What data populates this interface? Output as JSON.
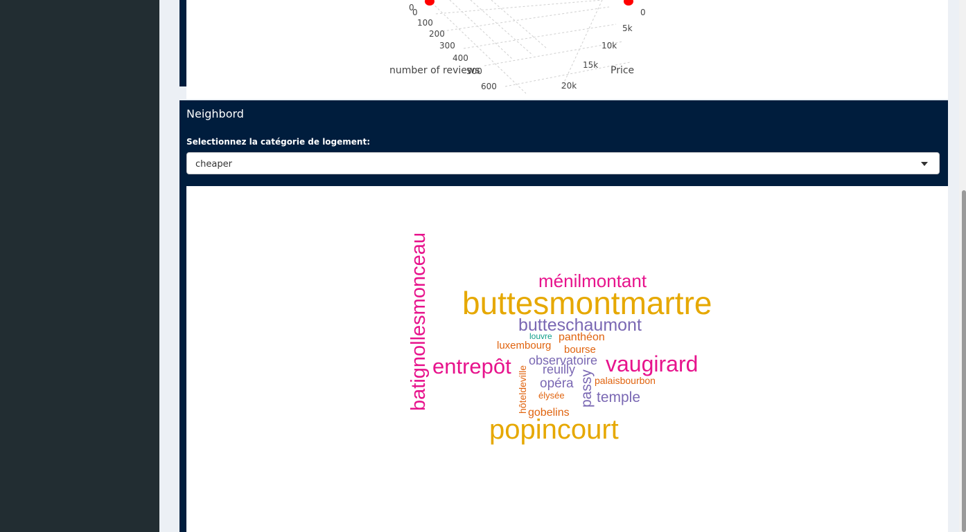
{
  "chart3d": {
    "x_axis_title": "number of reviews",
    "x_ticks": [
      "0",
      "100",
      "200",
      "300",
      "400",
      "500",
      "600"
    ],
    "y_axis_title": "Price",
    "y_ticks": [
      "0",
      "5k",
      "10k",
      "15k",
      "20k"
    ],
    "z_tick_visible": "0",
    "point_color": "#ff0000"
  },
  "neighbord": {
    "title": "Neighbord",
    "select_label": "Selectionnez la catégorie de logement:",
    "select_value": "cheaper"
  },
  "wordcloud": {
    "words": [
      {
        "text": "buttesmontmartre",
        "color": "#e6a800"
      },
      {
        "text": "popincourt",
        "color": "#e6a800"
      },
      {
        "text": "ménilmontant",
        "color": "#e7138c"
      },
      {
        "text": "vaugirard",
        "color": "#e7138c"
      },
      {
        "text": "entrepôt",
        "color": "#e7138c"
      },
      {
        "text": "batignollesmonceau",
        "color": "#e7138c"
      },
      {
        "text": "butteschaumont",
        "color": "#7a68b3"
      },
      {
        "text": "observatoire",
        "color": "#7a68b3"
      },
      {
        "text": "reuilly",
        "color": "#7a68b3"
      },
      {
        "text": "opéra",
        "color": "#7a68b3"
      },
      {
        "text": "temple",
        "color": "#7a68b3"
      },
      {
        "text": "passy",
        "color": "#7a68b3"
      },
      {
        "text": "panthéon",
        "color": "#e0630e"
      },
      {
        "text": "luxembourg",
        "color": "#e0630e"
      },
      {
        "text": "bourse",
        "color": "#e0630e"
      },
      {
        "text": "palaisbourbon",
        "color": "#e0630e"
      },
      {
        "text": "élysée",
        "color": "#e0630e"
      },
      {
        "text": "gobelins",
        "color": "#e0630e"
      },
      {
        "text": "hôteldeville",
        "color": "#e0630e"
      },
      {
        "text": "louvre",
        "color": "#109e8a"
      }
    ]
  }
}
